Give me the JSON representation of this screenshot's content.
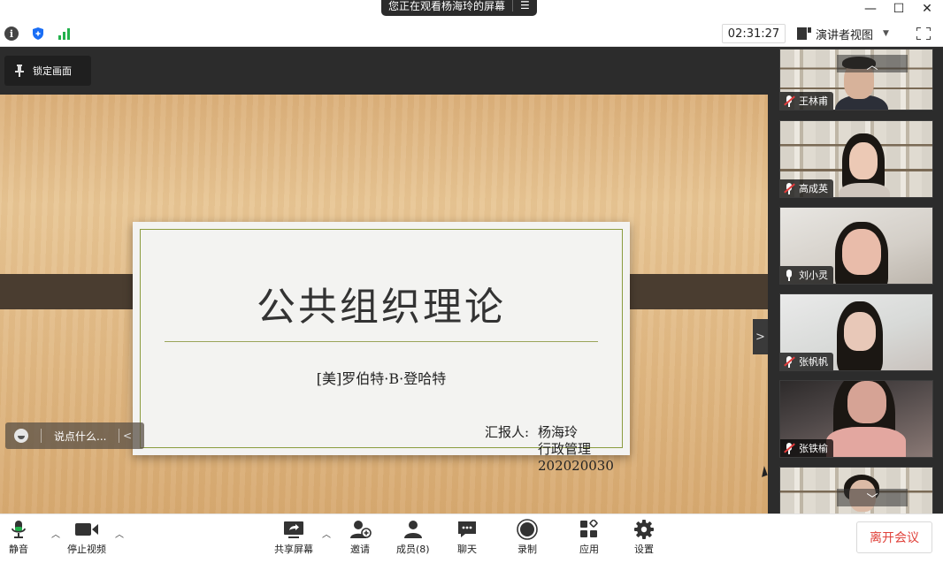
{
  "window": {
    "sharing_banner": "您正在观看杨海玲的屏幕",
    "minimize": "—",
    "maximize": "☐",
    "close": "✕"
  },
  "status": {
    "timer": "02:31:27",
    "view_mode_label": "演讲者视图"
  },
  "stage": {
    "lock_label": "锁定画面",
    "slide": {
      "title": "公共组织理论",
      "author": "[美]罗伯特·B·登哈特",
      "reporter_label": "汇报人:",
      "reporter_name": "杨海玲",
      "major": "行政管理",
      "student_id": "202020030"
    },
    "chat_placeholder": "说点什么..."
  },
  "gallery": {
    "participants": [
      {
        "name": "王林甫",
        "mic": "muted"
      },
      {
        "name": "高成英",
        "mic": "muted"
      },
      {
        "name": "刘小灵",
        "mic": "on"
      },
      {
        "name": "张帆帆",
        "mic": "muted"
      },
      {
        "name": "张铁榆",
        "mic": "muted"
      }
    ]
  },
  "toolbar": {
    "mute_label": "静音",
    "stop_video_label": "停止视频",
    "share_label": "共享屏幕",
    "invite_label": "邀请",
    "members_label": "成员(8)",
    "chat_label": "聊天",
    "record_label": "录制",
    "apps_label": "应用",
    "settings_label": "设置",
    "leave_label": "离开会议"
  },
  "colors": {
    "accent_blue": "#1a6ef5",
    "mic_green": "#22b14c",
    "leave_red": "#e0413a",
    "slide_rule": "#8b9c3f"
  }
}
